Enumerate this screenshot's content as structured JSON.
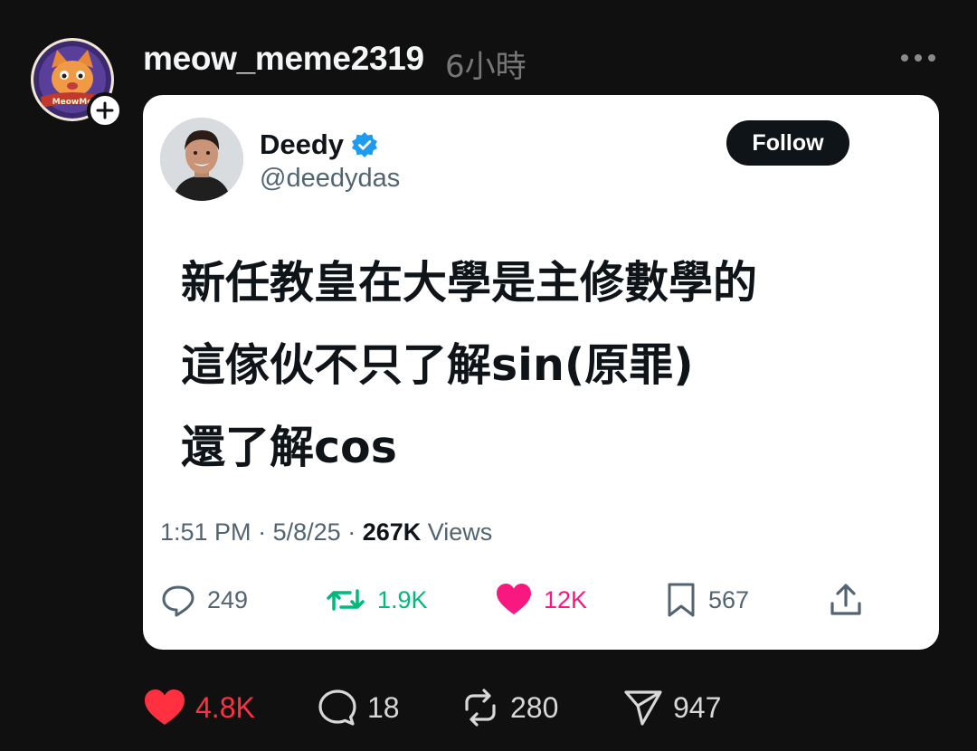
{
  "post": {
    "username": "meow_meme2319",
    "time": "6小時",
    "avatar_text": "MeowMe"
  },
  "tweet": {
    "name": "Deedy",
    "handle": "@deedydas",
    "follow_label": "Follow",
    "lines": [
      "新任教皇在大學是主修數學的",
      "這傢伙不只了解sin(原罪)",
      "還了解cos"
    ],
    "meta": {
      "time": "1:51 PM",
      "date": "5/8/25",
      "views_count": "267K",
      "views_label": "Views"
    },
    "stats": {
      "replies": "249",
      "retweets": "1.9K",
      "likes": "12K",
      "bookmarks": "567"
    },
    "colors": {
      "retweet": "#00ba7c",
      "like": "#f91880",
      "verified": "#1d9bf0"
    }
  },
  "actions": {
    "likes": "4.8K",
    "comments": "18",
    "reposts": "280",
    "shares": "947"
  },
  "colors": {
    "like_active": "#ff3040"
  }
}
